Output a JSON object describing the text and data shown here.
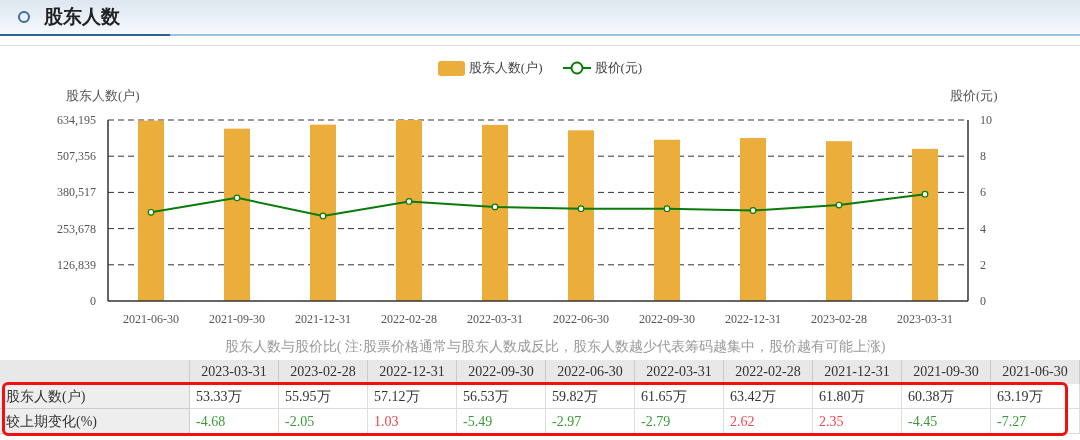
{
  "header": {
    "title": "股东人数"
  },
  "chart": {
    "chart_data": {
      "type": "bar",
      "ylabel": "股东人数(户)",
      "y2label": "股价(元)",
      "grid": true,
      "legend": true,
      "categories": [
        "2021-06-30",
        "2021-09-30",
        "2021-12-31",
        "2022-02-28",
        "2022-03-31",
        "2022-06-30",
        "2022-09-30",
        "2022-12-31",
        "2023-02-28",
        "2023-03-31"
      ],
      "series": [
        {
          "name": "股东人数(户)",
          "color": "#ebae3b",
          "type": "bar",
          "values": [
            632000,
            604000,
            618000,
            634000,
            617000,
            598000,
            565000,
            571000,
            560000,
            533000
          ]
        },
        {
          "name": "股价(元)",
          "color": "#0a7a0a",
          "type": "line",
          "axis": "y2",
          "marker": "circle",
          "values": [
            4.9,
            5.7,
            4.7,
            5.5,
            5.2,
            5.1,
            5.1,
            5.0,
            5.3,
            5.9
          ]
        }
      ],
      "ylim": [
        0,
        634195
      ],
      "yticks": [
        {
          "value": 0,
          "label": "0"
        },
        {
          "value": 126839,
          "label": "126,839"
        },
        {
          "value": 253678,
          "label": "253,678"
        },
        {
          "value": 380517,
          "label": "380,517"
        },
        {
          "value": 507356,
          "label": "507,356"
        },
        {
          "value": 634195,
          "label": "634,195"
        }
      ],
      "y2lim": [
        0,
        10
      ],
      "y2ticks": [
        0,
        2,
        4,
        6,
        8,
        10
      ]
    }
  },
  "table": {
    "caption": "股东人数与股价比( 注:股票价格通常与股东人数成反比，股东人数越少代表筹码越集中，股价越有可能上涨)",
    "columns": [
      "2023-03-31",
      "2023-02-28",
      "2022-12-31",
      "2022-09-30",
      "2022-06-30",
      "2022-03-31",
      "2022-02-28",
      "2021-12-31",
      "2021-09-30",
      "2021-06-30"
    ],
    "rows": [
      {
        "label": "股东人数(户)",
        "highlighted": true,
        "cells": [
          {
            "text": "53.33万"
          },
          {
            "text": "55.95万"
          },
          {
            "text": "57.12万"
          },
          {
            "text": "56.53万"
          },
          {
            "text": "59.82万"
          },
          {
            "text": "61.65万"
          },
          {
            "text": "63.42万"
          },
          {
            "text": "61.80万"
          },
          {
            "text": "60.38万"
          },
          {
            "text": "63.19万"
          }
        ]
      },
      {
        "label": "较上期变化(%)",
        "highlighted": true,
        "cells": [
          {
            "text": "-4.68",
            "color": "#3a9a3a"
          },
          {
            "text": "-2.05",
            "color": "#3a9a3a"
          },
          {
            "text": "1.03",
            "color": "#f0474e"
          },
          {
            "text": "-5.49",
            "color": "#3a9a3a"
          },
          {
            "text": "-2.97",
            "color": "#3a9a3a"
          },
          {
            "text": "-2.79",
            "color": "#3a9a3a"
          },
          {
            "text": "2.62",
            "color": "#f0474e"
          },
          {
            "text": "2.35",
            "color": "#f0474e"
          },
          {
            "text": "-4.45",
            "color": "#3a9a3a"
          },
          {
            "text": "-7.27",
            "color": "#3a9a3a"
          }
        ]
      }
    ]
  }
}
